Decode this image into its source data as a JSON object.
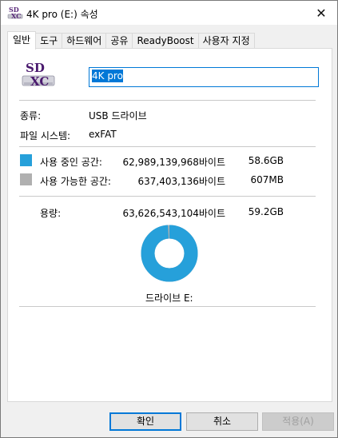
{
  "window": {
    "title": "4K pro (E:) 속성",
    "close_glyph": "✕"
  },
  "tabs": [
    {
      "label": "일반",
      "active": true
    },
    {
      "label": "도구",
      "active": false
    },
    {
      "label": "하드웨어",
      "active": false
    },
    {
      "label": "공유",
      "active": false
    },
    {
      "label": "ReadyBoost",
      "active": false
    },
    {
      "label": "사용자 지정",
      "active": false
    }
  ],
  "general": {
    "icon_text_top": "SD",
    "icon_text_bottom": "XC",
    "drive_name": "4K pro",
    "type_label": "종류:",
    "type_value": "USB 드라이브",
    "fs_label": "파일 시스템:",
    "fs_value": "exFAT",
    "used_label": "사용 중인 공간:",
    "used_bytes": "62,989,139,968바이트",
    "used_size": "58.6GB",
    "free_label": "사용 가능한 공간:",
    "free_bytes": "637,403,136바이트",
    "free_size": "607MB",
    "capacity_label": "용량:",
    "capacity_bytes": "63,626,543,104바이트",
    "capacity_size": "59.2GB",
    "drive_caption": "드라이브 E:",
    "used_fraction": 0.99,
    "used_color": "#26a0da",
    "free_color": "#b0b0b0"
  },
  "buttons": {
    "ok": "확인",
    "cancel": "취소",
    "apply": "적용(A)"
  }
}
